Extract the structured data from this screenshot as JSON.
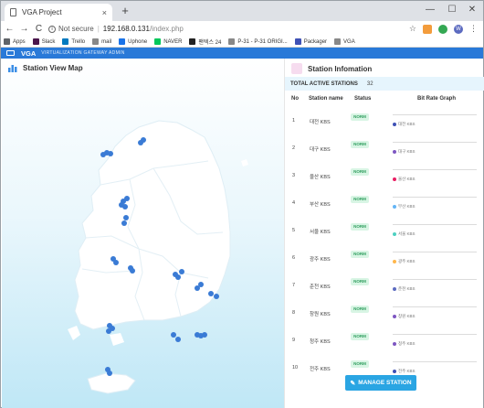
{
  "browser": {
    "tab_title": "VGA Project",
    "tab_close": "×",
    "new_tab": "+",
    "window_controls": {
      "minimize": "—",
      "maximize": "☐",
      "close": "✕"
    },
    "nav": {
      "back": "←",
      "forward": "→",
      "reload": "C"
    },
    "omnibox": {
      "security": "Not secure",
      "separator": "|",
      "host": "192.168.0.131",
      "path": "/index.php"
    },
    "profile_initial": "W",
    "bookmarks": [
      {
        "label": "Apps",
        "icon": "apps-grid-icon",
        "color": "#5f6368"
      },
      {
        "label": "Slack",
        "icon": "slack-icon",
        "color": "#4a154b"
      },
      {
        "label": "Trello",
        "icon": "trello-icon",
        "color": "#0079bf"
      },
      {
        "label": "mail",
        "icon": "page-icon",
        "color": "#888888"
      },
      {
        "label": "Uphone",
        "icon": "uphone-icon",
        "color": "#1a73e8"
      },
      {
        "label": "NAVER",
        "icon": "naver-icon",
        "color": "#03c75a"
      },
      {
        "label": "팬텍스 24",
        "icon": "pantech-icon",
        "color": "#222222"
      },
      {
        "label": "P-31 - P-31 ORIGI...",
        "icon": "page-icon",
        "color": "#888888"
      },
      {
        "label": "Packager",
        "icon": "packager-icon",
        "color": "#3f51b5"
      },
      {
        "label": "VGA",
        "icon": "page-icon",
        "color": "#888888"
      }
    ]
  },
  "app": {
    "brand": "VGA",
    "subtitle": "VIRTUALIZATION GATEWAY ADMIN",
    "accent": "#2979d8"
  },
  "map_panel": {
    "title": "Station View Map",
    "marker_color": "#3a7bd5"
  },
  "station_panel": {
    "title": "Station Infomation",
    "total_label": "TOTAL ACTIVE STATIONS",
    "total_count": "32",
    "columns": {
      "no": "No",
      "name": "Station name",
      "status": "Status",
      "graph": "Bit Rate Graph"
    },
    "rows": [
      {
        "no": "1",
        "name": "대전 KBS",
        "status": "NORM",
        "legend": "대전 KBS",
        "color": "#3f51b5"
      },
      {
        "no": "2",
        "name": "대구 KBS",
        "status": "NORM",
        "legend": "대구 KBS",
        "color": "#7e57c2"
      },
      {
        "no": "3",
        "name": "울산 KBS",
        "status": "NORM",
        "legend": "울산 KBS",
        "color": "#e91e63"
      },
      {
        "no": "4",
        "name": "부산 KBS",
        "status": "NORM",
        "legend": "부산 KBS",
        "color": "#64b5f6"
      },
      {
        "no": "5",
        "name": "서울 KBS",
        "status": "NORM",
        "legend": "서울 KBS",
        "color": "#4dd0c1"
      },
      {
        "no": "6",
        "name": "광주 KBS",
        "status": "NORM",
        "legend": "광주 KBS",
        "color": "#ffb74d"
      },
      {
        "no": "7",
        "name": "춘천 KBS",
        "status": "NORM",
        "legend": "춘천 KBS",
        "color": "#5c6bc0"
      },
      {
        "no": "8",
        "name": "창원 KBS",
        "status": "NORM",
        "legend": "창원 KBS",
        "color": "#7e57c2"
      },
      {
        "no": "9",
        "name": "청주 KBS",
        "status": "NORM",
        "legend": "청주 KBS",
        "color": "#7e57c2"
      },
      {
        "no": "10",
        "name": "전주 KBS",
        "status": "NORM",
        "legend": "전주 KBS",
        "color": "#3f51b5"
      }
    ],
    "manage_button": "MANAGE STATION"
  }
}
